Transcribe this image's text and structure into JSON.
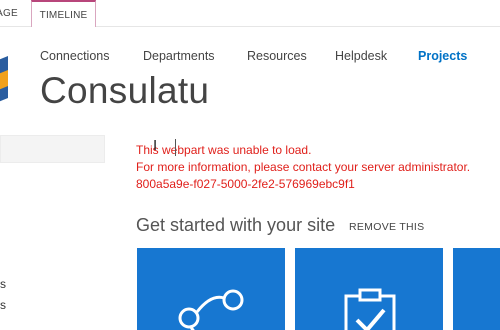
{
  "ribbon": {
    "tabs": [
      {
        "label": "PAGE"
      },
      {
        "label": "TIMELINE"
      }
    ]
  },
  "nav": {
    "links": [
      "Connections",
      "Departments",
      "Resources",
      "Helpdesk",
      "Projects"
    ],
    "active": "Projects"
  },
  "site": {
    "title": "Consulatu"
  },
  "error": {
    "line1": "This webpart was unable to load.",
    "line2": "For more information, please contact your server administrator.",
    "line3": "800a5a9e-f027-5000-2fe2-576969ebc9f1"
  },
  "getstarted": {
    "title": "Get started with your site",
    "remove_label": "REMOVE THIS"
  },
  "left": {
    "fragments": [
      "s",
      "s"
    ]
  },
  "colors": {
    "accent": "#0072c6",
    "tile": "#1777d1",
    "error": "#e0201b",
    "timeline_tab": "#b8467b"
  }
}
